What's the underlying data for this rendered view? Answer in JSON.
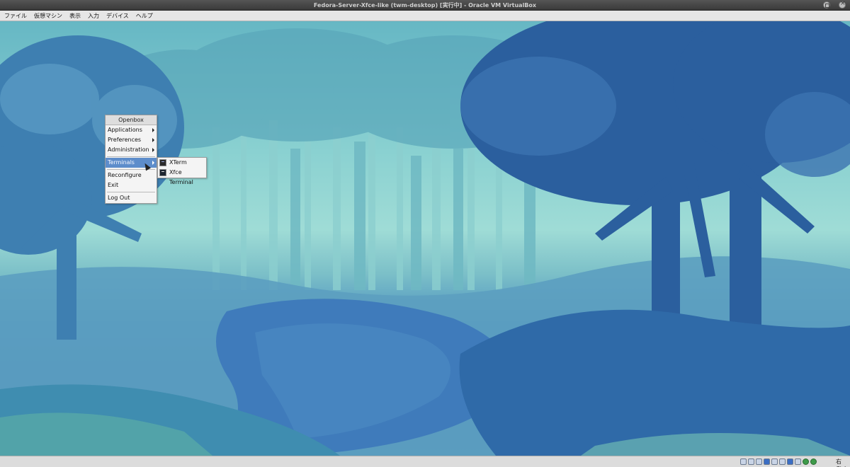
{
  "window": {
    "title": "Fedora-Server-Xfce-like (twm-desktop) [実行中] - Oracle VM VirtualBox"
  },
  "menubar": {
    "items": [
      "ファイル",
      "仮想マシン",
      "表示",
      "入力",
      "デバイス",
      "ヘルプ"
    ]
  },
  "root_menu": {
    "title": "Openbox",
    "applications": "Applications",
    "preferences": "Preferences",
    "administration": "Administration",
    "terminals": "Terminals",
    "reconfigure": "Reconfigure",
    "exit": "Exit",
    "logout": "Log Out"
  },
  "terminals_submenu": {
    "xterm": "XTerm",
    "xfce_terminal": "Xfce Terminal"
  },
  "statusbar": {
    "host_key": "右 Ctrl",
    "icons": [
      "hard-disk-icon",
      "optical-drive-icon",
      "audio-icon",
      "network-icon",
      "usb-icon",
      "shared-folder-icon",
      "display-icon",
      "video-capture-icon",
      "mouse-integration-icon",
      "keyboard-icon",
      "guest-additions-icon"
    ]
  },
  "colors": {
    "menu_highlight": "#5d8dcb",
    "titlebar": "#3a3a3a",
    "desktop_accent": "#4a8fbf"
  }
}
